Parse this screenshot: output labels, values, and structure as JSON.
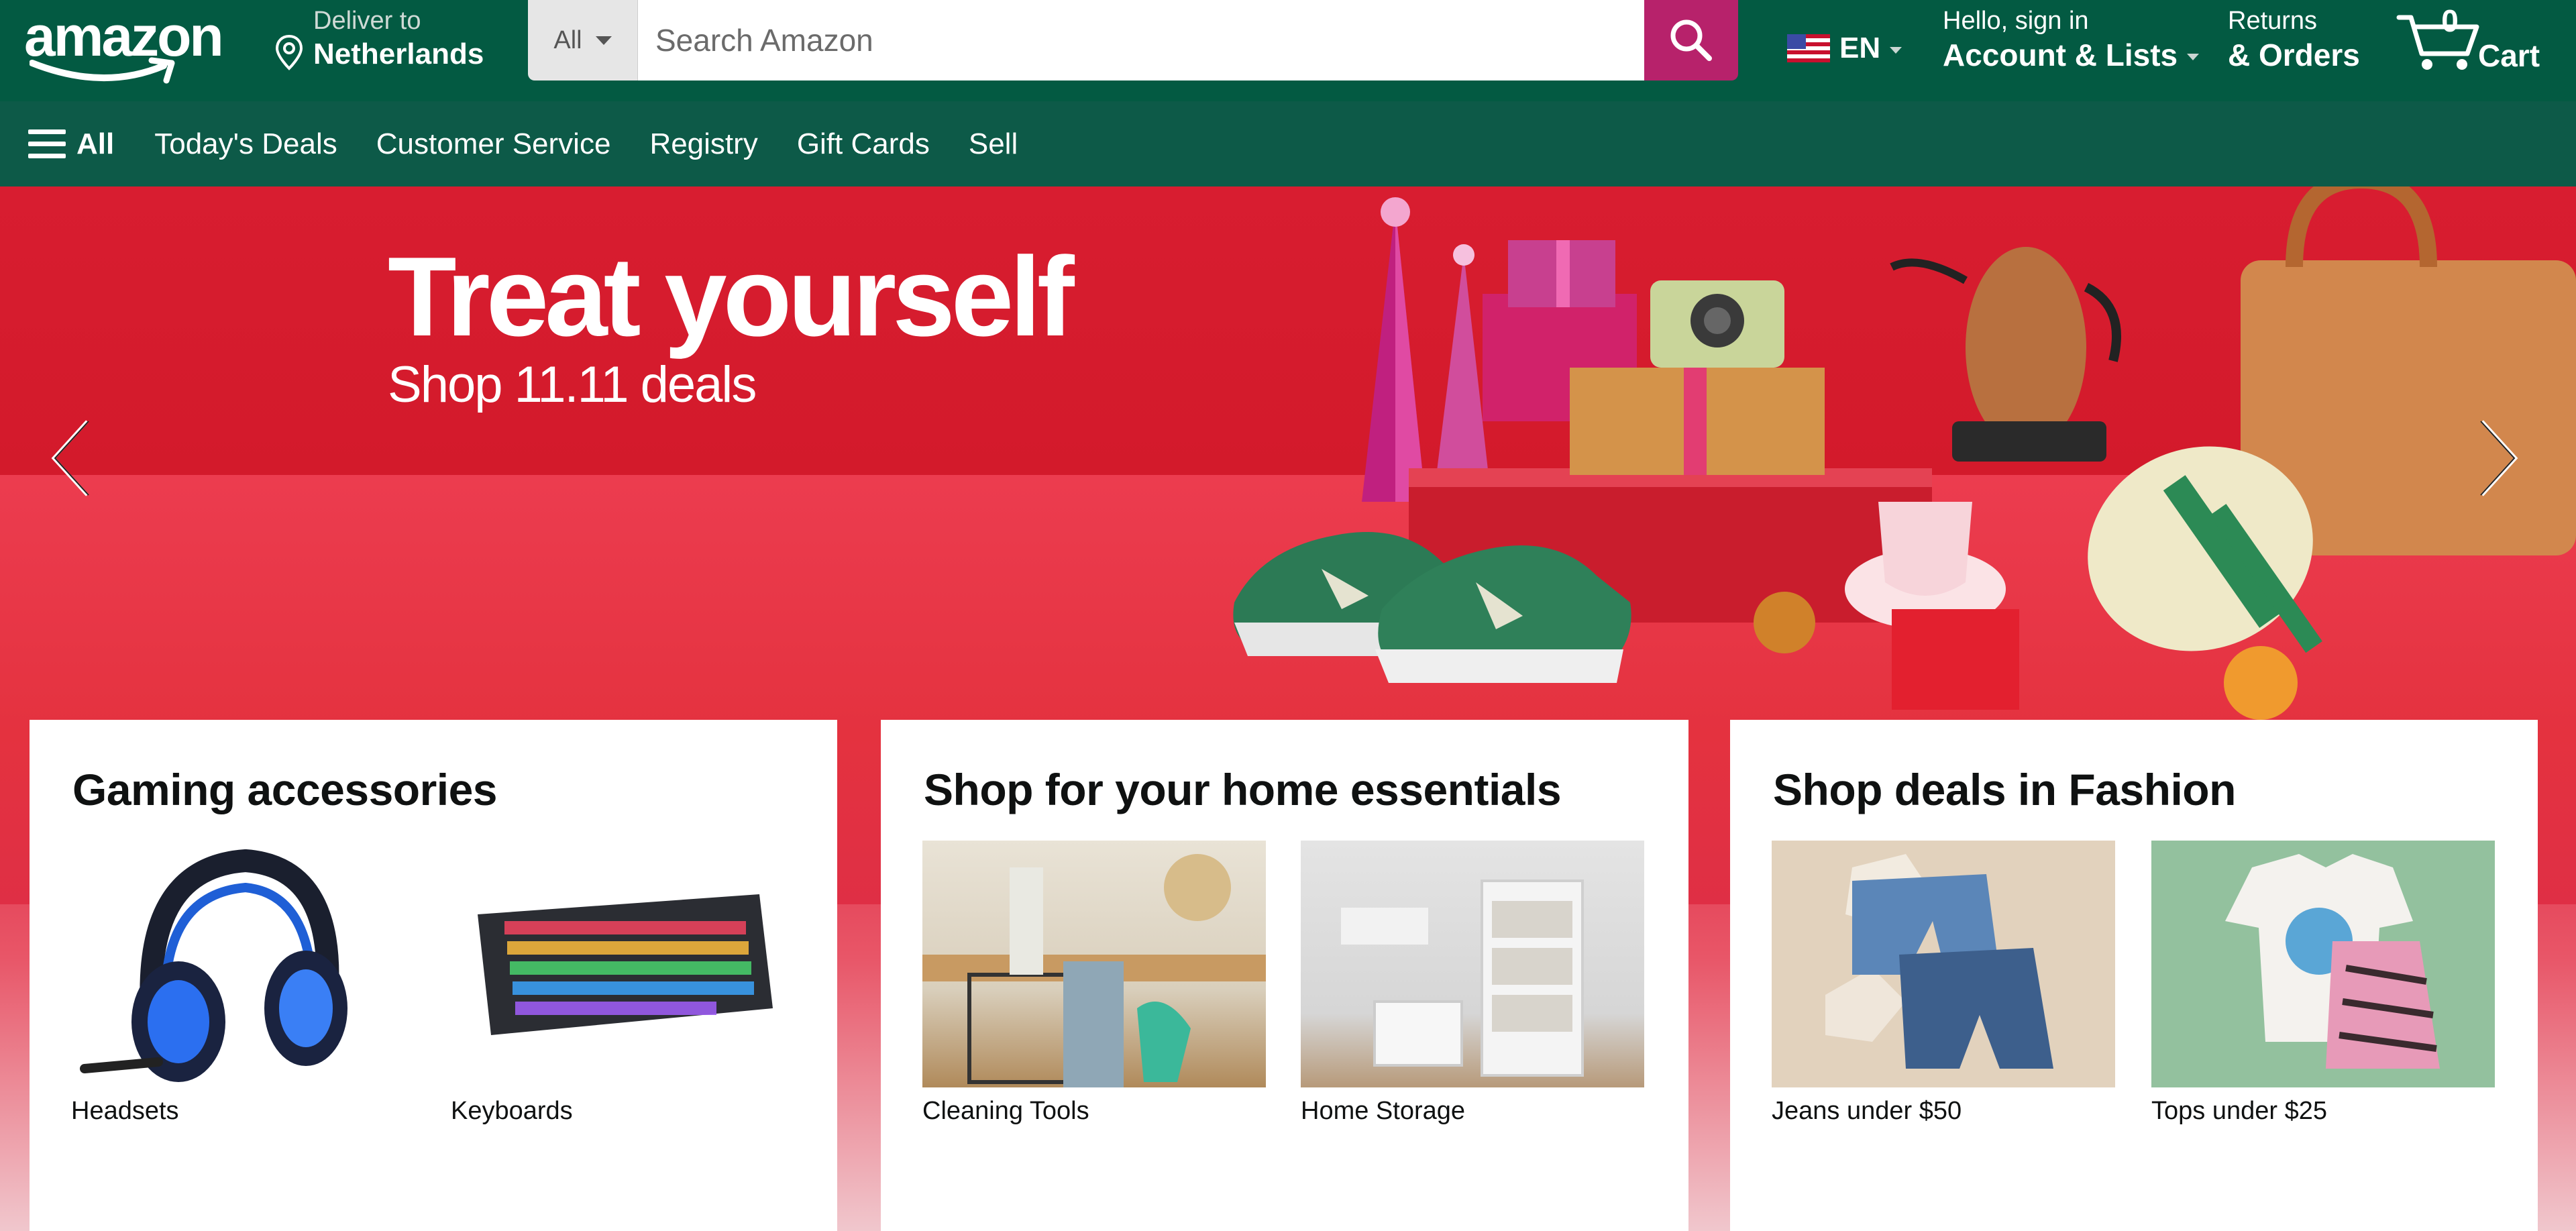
{
  "header": {
    "logo_text": "amazon",
    "deliver_line1": "Deliver to",
    "deliver_line2": "Netherlands",
    "search_category": "All",
    "search_placeholder": "Search Amazon",
    "language": "EN",
    "account_line1": "Hello, sign in",
    "account_line2": "Account & Lists",
    "returns_line1": "Returns",
    "returns_line2": "& Orders",
    "cart_count": "0",
    "cart_label": "Cart"
  },
  "subnav": {
    "all_label": "All",
    "links": [
      "Today's Deals",
      "Customer Service",
      "Registry",
      "Gift Cards",
      "Sell"
    ]
  },
  "hero": {
    "title": "Treat yourself",
    "subtitle": "Shop 11.11 deals"
  },
  "cards": [
    {
      "title": "Gaming accessories",
      "tiles": [
        "Headsets",
        "Keyboards"
      ]
    },
    {
      "title": "Shop for your home essentials",
      "tiles": [
        "Cleaning Tools",
        "Home Storage"
      ]
    },
    {
      "title": "Shop deals in Fashion",
      "tiles": [
        "Jeans under $50",
        "Tops under $25"
      ]
    }
  ],
  "colors": {
    "nav_top": "#035a42",
    "nav_sub": "#0d5a48",
    "search_button": "#b7226b",
    "hero_red": "#d81d30"
  }
}
